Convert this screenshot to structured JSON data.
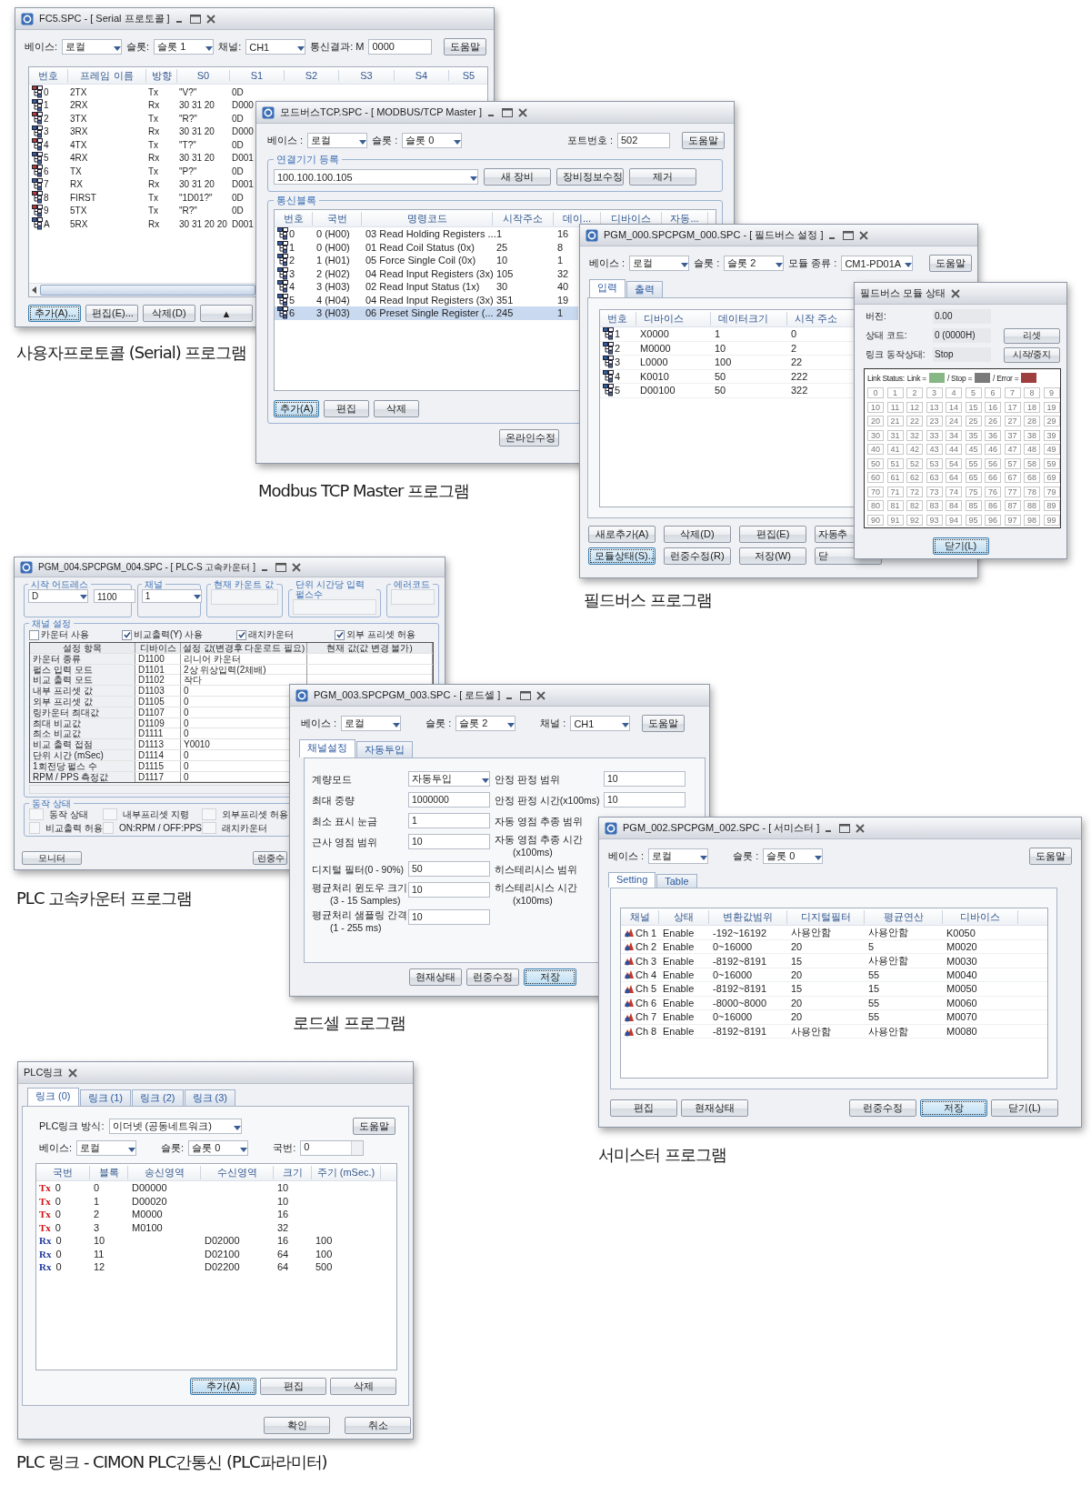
{
  "serial": {
    "title": "FC5.SPC - [ Serial 프로토콜 ]",
    "caption": "사용자프로토콜 (Serial) 프로그램",
    "fields": [
      {
        "label": "베이스:",
        "value": "로컬",
        "kind": "combo"
      },
      {
        "label": "슬롯:",
        "value": "슬롯 1",
        "kind": "combo"
      },
      {
        "label": "채널:",
        "value": "CH1",
        "kind": "combo"
      },
      {
        "label": "통신결과: M",
        "value": "0000",
        "kind": "text"
      }
    ],
    "help": "도움말",
    "columns": [
      "번호",
      "프레임 이름",
      "방향",
      "S0",
      "S1",
      "S2",
      "S3",
      "S4",
      "S5"
    ],
    "rows": [
      {
        "kind": "tx",
        "cells": [
          "0",
          "2TX",
          "Tx",
          "\"V?\"",
          "0D"
        ]
      },
      {
        "kind": "rx",
        "cells": [
          "1",
          "2RX",
          "Rx",
          "30 31 20",
          "D000"
        ]
      },
      {
        "kind": "tx",
        "cells": [
          "2",
          "3TX",
          "Tx",
          "\"R?\"",
          "0D"
        ]
      },
      {
        "kind": "rx",
        "cells": [
          "3",
          "3RX",
          "Rx",
          "30 31 20",
          "D000"
        ]
      },
      {
        "kind": "tx",
        "cells": [
          "4",
          "4TX",
          "Tx",
          "\"T?\"",
          "0D"
        ]
      },
      {
        "kind": "rx",
        "cells": [
          "5",
          "4RX",
          "Rx",
          "30 31 20",
          "D001"
        ]
      },
      {
        "kind": "tx",
        "cells": [
          "6",
          "TX",
          "Tx",
          "\"P?\"",
          "0D"
        ]
      },
      {
        "kind": "rx",
        "cells": [
          "7",
          "RX",
          "Rx",
          "30 31 20",
          "D001"
        ]
      },
      {
        "kind": "tx",
        "cells": [
          "8",
          "FIRST",
          "Tx",
          "\"1D01?\"",
          "0D"
        ]
      },
      {
        "kind": "tx",
        "cells": [
          "9",
          "5TX",
          "Tx",
          "\"R?\"",
          "0D"
        ]
      },
      {
        "kind": "rx",
        "cells": [
          "A",
          "5RX",
          "Rx",
          "30 31 20 20",
          "D001"
        ]
      }
    ],
    "buttons": [
      {
        "label": "추가(A)...",
        "focused": true
      },
      {
        "label": "편집(E)...",
        "focused": false
      },
      {
        "label": "삭제(D)",
        "focused": false
      },
      {
        "label": "▲",
        "focused": false
      }
    ]
  },
  "modbus": {
    "title": "모드버스TCP.SPC - [ MODBUS/TCP Master ]",
    "caption": "Modbus TCP Master 프로그램",
    "fields": [
      {
        "label": "베이스 :",
        "value": "로컬"
      },
      {
        "label": "슬롯 :",
        "value": "슬롯 0"
      }
    ],
    "port": {
      "label": "포트번호 :",
      "value": "502"
    },
    "help": "도움말",
    "device_group": {
      "legend": "연결기기 등록",
      "value": "100.100.100.105",
      "buttons": [
        "새  장비",
        "장비정보수정",
        "제거"
      ]
    },
    "block_group": {
      "legend": "통신블록",
      "columns": [
        "번호",
        "국번",
        "명령코드",
        "시작주소",
        "데이...",
        "디바이스",
        "자동..."
      ],
      "rows": [
        {
          "selected": false,
          "cells": [
            "0",
            "0 (H00)",
            "03 Read Holding Registers ...",
            "1",
            "16"
          ]
        },
        {
          "selected": false,
          "cells": [
            "1",
            "0 (H00)",
            "01 Read Coil Status (0x)",
            "25",
            "8"
          ]
        },
        {
          "selected": false,
          "cells": [
            "2",
            "1 (H01)",
            "05 Force Single Coil (0x)",
            "10",
            "1"
          ]
        },
        {
          "selected": false,
          "cells": [
            "3",
            "2 (H02)",
            "04 Read Input Registers (3x)",
            "105",
            "32"
          ]
        },
        {
          "selected": false,
          "cells": [
            "4",
            "3 (H03)",
            "02 Read Input Status (1x)",
            "30",
            "40"
          ]
        },
        {
          "selected": false,
          "cells": [
            "5",
            "4 (H04)",
            "04 Read Input Registers (3x)",
            "351",
            "19"
          ]
        },
        {
          "selected": true,
          "cells": [
            "6",
            "3 (H03)",
            "06 Preset Single Register (...",
            "245",
            "1"
          ]
        }
      ],
      "buttons": [
        {
          "label": "추가(A)",
          "focused": true
        },
        {
          "label": "편집",
          "focused": false
        },
        {
          "label": "삭제",
          "focused": false
        }
      ]
    },
    "online": "온라인수정"
  },
  "fieldbus": {
    "title": "PGM_000.SPCPGM_000.SPC - [ 필드버스 설정 ]",
    "caption": "필드버스 프로그램",
    "fields": [
      {
        "label": "베이스 :",
        "value": "로컬"
      },
      {
        "label": "슬롯 :",
        "value": "슬롯 2"
      },
      {
        "label": "모듈 종류 :",
        "value": "CM1-PD01A"
      }
    ],
    "help": "도움말",
    "tabs": [
      {
        "label": "입력",
        "selected": true
      },
      {
        "label": "출력",
        "selected": false
      }
    ],
    "columns": [
      "번호",
      "디바이스",
      "데이터크기",
      "시작 주소"
    ],
    "rows": [
      [
        "1",
        "X0000",
        "1",
        "0"
      ],
      [
        "2",
        "M0000",
        "10",
        "2"
      ],
      [
        "3",
        "L0000",
        "100",
        "22"
      ],
      [
        "4",
        "K0010",
        "50",
        "222"
      ],
      [
        "5",
        "D00100",
        "50",
        "322"
      ]
    ],
    "button_rows": [
      [
        {
          "label": "새로추가(A)",
          "focused": false
        },
        {
          "label": "삭제(D)",
          "focused": false
        },
        {
          "label": "편집(E)",
          "focused": false
        },
        {
          "label": "자동추",
          "focused": false
        }
      ],
      [
        {
          "label": "모듈상태(S)...",
          "focused": true
        },
        {
          "label": "런중수정(R)",
          "focused": false
        },
        {
          "label": "저장(W)",
          "focused": false
        },
        {
          "label": "닫",
          "focused": false
        }
      ]
    ]
  },
  "module_status": {
    "title": "필드버스 모듈 상태",
    "rows": [
      {
        "label": "버전:",
        "value": "0.00"
      },
      {
        "label": "상태 코드:",
        "value": "0 (0000H)",
        "button": "리셋"
      },
      {
        "label": "링크 동작상태:",
        "value": "Stop",
        "button": "시작/중지"
      }
    ],
    "legend_title": "Link Status:",
    "legend": [
      {
        "label": "Link =",
        "color": "#86b784"
      },
      {
        "label": "/ Stop =",
        "color": "#7a7a7a"
      },
      {
        "label": "/ Error =",
        "color": "#9e3e3e"
      }
    ],
    "stations": [
      "0",
      "1",
      "2",
      "3",
      "4",
      "5",
      "6",
      "7",
      "8",
      "9",
      "10",
      "11",
      "12",
      "13",
      "14",
      "15",
      "16",
      "17",
      "18",
      "19",
      "20",
      "21",
      "22",
      "23",
      "24",
      "25",
      "26",
      "27",
      "28",
      "29",
      "30",
      "31",
      "32",
      "33",
      "34",
      "35",
      "36",
      "37",
      "38",
      "39",
      "40",
      "41",
      "42",
      "43",
      "44",
      "45",
      "46",
      "47",
      "48",
      "49",
      "50",
      "51",
      "52",
      "53",
      "54",
      "55",
      "56",
      "57",
      "58",
      "59",
      "60",
      "61",
      "62",
      "63",
      "64",
      "65",
      "66",
      "67",
      "68",
      "69",
      "70",
      "71",
      "72",
      "73",
      "74",
      "75",
      "76",
      "77",
      "78",
      "79",
      "80",
      "81",
      "82",
      "83",
      "84",
      "85",
      "86",
      "87",
      "88",
      "89",
      "90",
      "91",
      "92",
      "93",
      "94",
      "95",
      "96",
      "97",
      "98",
      "99"
    ],
    "close": "닫기(L)"
  },
  "counter": {
    "title": "PGM_004.SPCPGM_004.SPC - [ PLC-S 고속카운터 ]",
    "caption": "PLC 고속카운터 프로그램",
    "top_groups": [
      {
        "legend": "시작 어드레스",
        "fields": [
          {
            "kind": "combo",
            "value": "D"
          },
          {
            "kind": "text",
            "value": "1100"
          }
        ]
      },
      {
        "legend": "채널",
        "fields": [
          {
            "kind": "combo",
            "value": "1"
          }
        ]
      },
      {
        "legend": "현재 카운트 값",
        "fields": [
          {
            "kind": "readonly"
          }
        ]
      },
      {
        "legend": "단위 시간당 입력 펄스수",
        "fields": [
          {
            "kind": "readonly"
          }
        ]
      },
      {
        "legend": "에러코드",
        "fields": [
          {
            "kind": "readonly"
          }
        ]
      }
    ],
    "channel_legend": "채널 설정",
    "checks": [
      {
        "label": "카운터 사용",
        "checked": false
      },
      {
        "label": "비교출력(Y) 사용",
        "checked": true
      },
      {
        "label": "래치카운터",
        "checked": true
      },
      {
        "label": "외부 프리셋 허용",
        "checked": true
      }
    ],
    "columns": [
      "설정 항목",
      "디바이스",
      "설정 값(변경후 다운로드 필요)",
      "현재 값(값 변경 불가)"
    ],
    "rows": [
      [
        "카운터 종류",
        "D1100",
        "리니어 카운터"
      ],
      [
        "펄스 입력 모드",
        "D1101",
        "2상 위상입력(2체배)"
      ],
      [
        "비교 출력 모드",
        "D1102",
        "작다"
      ],
      [
        "내부 프리셋 값",
        "D1103",
        "0"
      ],
      [
        "외부 프리셋 값",
        "D1105",
        "0"
      ],
      [
        "링카운터 최대값",
        "D1107",
        "0"
      ],
      [
        "최대 비교값",
        "D1109",
        "0"
      ],
      [
        "최소 비교값",
        "D1111",
        "0"
      ],
      [
        "비교 출력 접점",
        "D1113",
        "Y0010"
      ],
      [
        "단위 시간 (mSec)",
        "D1114",
        "0"
      ],
      [
        "1회전당 펄스 수",
        "D1115",
        "0"
      ],
      [
        "RPM / PPS 측정값",
        "D1117",
        "0"
      ]
    ],
    "status_legend": "동작 상태",
    "status_items": [
      "동작 상태",
      "내부프리셋 지령",
      "외부프리셋 허용",
      "비교출력 허용",
      "ON:RPM / OFF:PPS",
      "래치카운터"
    ],
    "buttons": [
      "모니터",
      "런중수"
    ]
  },
  "loadcell": {
    "title": "PGM_003.SPCPGM_003.SPC - [ 로드셀 ]",
    "caption": "로드셀 프로그램",
    "fields": [
      {
        "label": "베이스 :",
        "value": "로컬"
      },
      {
        "label": "슬롯 :",
        "value": "슬롯 2"
      },
      {
        "label": "채널 :",
        "value": "CH1"
      }
    ],
    "help": "도움말",
    "tabs": [
      {
        "label": "채널설정",
        "selected": true
      },
      {
        "label": "자동투입",
        "selected": false
      }
    ],
    "left": [
      {
        "label": "계량모드",
        "value": "자동투입",
        "kind": "combo"
      },
      {
        "label": "최대 중량",
        "value": "1000000",
        "kind": "text"
      },
      {
        "label": "최소 표시 눈금",
        "value": "1",
        "kind": "text"
      },
      {
        "label": "근사 영점 범위",
        "value": "10",
        "kind": "text"
      },
      {
        "label": "디지털 필터(0 - 90%)",
        "value": "50",
        "kind": "text"
      },
      {
        "label": "평균처리 윈도우 크기",
        "sub": "(3 - 15 Samples)",
        "value": "10",
        "kind": "text"
      },
      {
        "label": "평균처리 샘플링 간격",
        "sub": "(1 - 255 ms)",
        "value": "10",
        "kind": "text"
      }
    ],
    "right": [
      {
        "label": "안정 판정 범위",
        "value": "10"
      },
      {
        "label": "안정 판정 시간(x100ms)",
        "value": "10"
      },
      {
        "label": "자동 영점 추종 범위"
      },
      {
        "label": "자동 영점 추종 시간",
        "sub": "(x100ms)"
      },
      {
        "label": "히스테리시스 범위"
      },
      {
        "label": "히스테리시스 시간",
        "sub": "(x100ms)"
      }
    ],
    "buttons": [
      {
        "label": "현재상태",
        "focused": false
      },
      {
        "label": "런중수정",
        "focused": false
      },
      {
        "label": "저장",
        "focused": true
      }
    ]
  },
  "thermistor": {
    "title": "PGM_002.SPCPGM_002.SPC - [ 서미스터 ]",
    "caption": "서미스터 프로그램",
    "fields": [
      {
        "label": "베이스 :",
        "value": "로컬"
      },
      {
        "label": "슬롯 :",
        "value": "슬롯 0"
      }
    ],
    "help": "도움말",
    "tabs": [
      {
        "label": "Setting",
        "selected": true
      },
      {
        "label": "Table",
        "selected": false
      }
    ],
    "columns": [
      "채널",
      "상태",
      "변환값범위",
      "디지털필터",
      "평균연산",
      "디바이스"
    ],
    "rows": [
      [
        "Ch 1",
        "Enable",
        "-192~16192",
        "사용안함",
        "사용안함",
        "K0050"
      ],
      [
        "Ch 2",
        "Enable",
        "0~16000",
        "20",
        "5",
        "M0020"
      ],
      [
        "Ch 3",
        "Enable",
        "-8192~8191",
        "15",
        "사용안함",
        "M0030"
      ],
      [
        "Ch 4",
        "Enable",
        "0~16000",
        "20",
        "55",
        "M0040"
      ],
      [
        "Ch 5",
        "Enable",
        "-8192~8191",
        "15",
        "15",
        "M0050"
      ],
      [
        "Ch 6",
        "Enable",
        "-8000~8000",
        "20",
        "55",
        "M0060"
      ],
      [
        "Ch 7",
        "Enable",
        "0~16000",
        "20",
        "55",
        "M0070"
      ],
      [
        "Ch 8",
        "Enable",
        "-8192~8191",
        "사용안함",
        "사용안함",
        "M0080"
      ]
    ],
    "left_buttons": [
      {
        "label": "편집",
        "focused": false
      },
      {
        "label": "현재상태",
        "focused": false
      }
    ],
    "right_buttons": [
      {
        "label": "런중수정",
        "focused": false
      },
      {
        "label": "저장",
        "focused": true
      },
      {
        "label": "닫기(L)",
        "focused": false
      }
    ]
  },
  "plclink": {
    "title": "PLC링크",
    "caption": "PLC 링크 - CIMON PLC간통신 (PLC파라미터)",
    "tabs": [
      {
        "label": "링크 (0)",
        "selected": true
      },
      {
        "label": "링크 (1)",
        "selected": false
      },
      {
        "label": "링크 (2)",
        "selected": false
      },
      {
        "label": "링크 (3)",
        "selected": false
      }
    ],
    "method": {
      "label": "PLC링크 방식:",
      "value": "이더넷 (공동네트워크)"
    },
    "help": "도움말",
    "fields": [
      {
        "label": "베이스:",
        "value": "로컬"
      },
      {
        "label": "슬롯:",
        "value": "슬롯 0"
      }
    ],
    "station": {
      "label": "국번:",
      "value": "0"
    },
    "columns": [
      "국번",
      "블록",
      "송신영역",
      "수신영역",
      "크기",
      "주기 (mSec.)"
    ],
    "rows": [
      {
        "kind": "tx",
        "tag": "Tx",
        "station": "0",
        "block": "0",
        "send": "D00000",
        "size": "10"
      },
      {
        "kind": "tx",
        "tag": "Tx",
        "station": "0",
        "block": "1",
        "send": "D00020",
        "size": "10"
      },
      {
        "kind": "tx",
        "tag": "Tx",
        "station": "0",
        "block": "2",
        "send": "M0000",
        "size": "16"
      },
      {
        "kind": "tx",
        "tag": "Tx",
        "station": "0",
        "block": "3",
        "send": "M0100",
        "size": "32"
      },
      {
        "kind": "rx",
        "tag": "Rx",
        "station": "0",
        "block": "10",
        "recv": "D02000",
        "size": "16",
        "period": "100"
      },
      {
        "kind": "rx",
        "tag": "Rx",
        "station": "0",
        "block": "11",
        "recv": "D02100",
        "size": "64",
        "period": "100"
      },
      {
        "kind": "rx",
        "tag": "Rx",
        "station": "0",
        "block": "12",
        "recv": "D02200",
        "size": "64",
        "period": "500"
      }
    ],
    "buttons": [
      {
        "label": "추가(A)",
        "focused": true
      },
      {
        "label": "편집",
        "focused": false
      },
      {
        "label": "삭제",
        "focused": false
      }
    ],
    "dialog_buttons": [
      {
        "label": "확인",
        "focused": false
      },
      {
        "label": "취소",
        "focused": false
      }
    ]
  }
}
